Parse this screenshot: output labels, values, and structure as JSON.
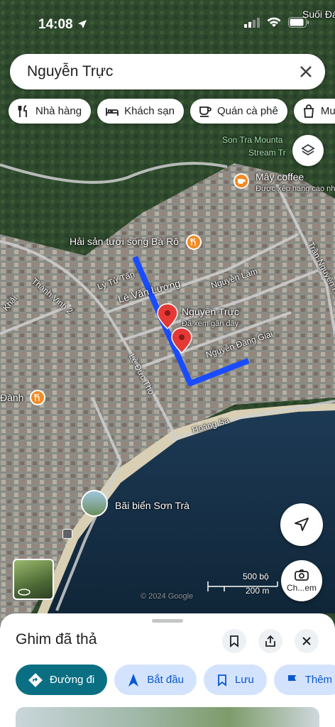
{
  "status": {
    "time": "14:08"
  },
  "search": {
    "query": "Nguyễn Trực"
  },
  "chips": [
    {
      "label": "Nhà hàng",
      "icon": "fork-knife-icon"
    },
    {
      "label": "Khách sạn",
      "icon": "bed-icon"
    },
    {
      "label": "Quán cà phê",
      "icon": "coffee-cup-icon"
    },
    {
      "label": "Mua",
      "icon": "shopping-bag-icon"
    }
  ],
  "map": {
    "top_right_label": "Suối Đá",
    "poi_green": "Son Tra Mountain Stream Tr",
    "poi_green_line1": "Son Tra Mounta",
    "poi_green_line2": "Stream Tr",
    "coffee_name": "Mây coffee",
    "coffee_sub": "Được xếp hạng cao nh",
    "seafood_name": "Hải sản tươi sống Bà Rô",
    "pin_title": "Nguyễn Trực",
    "pin_sub": "Đã xem gần đây",
    "roads": {
      "ly_tu_tan": "Lý Tử Tấn",
      "le_van_luong": "Lê Văn Lương",
      "nguyen_lam": "Nguyễn Lâm",
      "nguyen_dang_giai": "Nguyễn Đăng Giai",
      "le_duc_tho": "Lê Đức Thọ",
      "hoang_sa": "Hoàng Sa",
      "thanh_vinh_2": "Thành Vinh 2",
      "khai": "Khải",
      "tran_nguyen_han": "Trần Nguyên Hãn",
      "danh": "Đành"
    },
    "beach_name": "Bãi biển Sơn Trà",
    "scale_ft": "500 bộ",
    "scale_m": "200 m",
    "watermark": "© 2024 Google",
    "streetview_label": "Ch...em",
    "accent": "#1a4cff"
  },
  "sheet": {
    "title": "Ghim đã thả",
    "actions": [
      {
        "label": "Đường đi"
      },
      {
        "label": "Bắt đầu"
      },
      {
        "label": "Lưu"
      },
      {
        "label": "Thêm"
      }
    ]
  }
}
